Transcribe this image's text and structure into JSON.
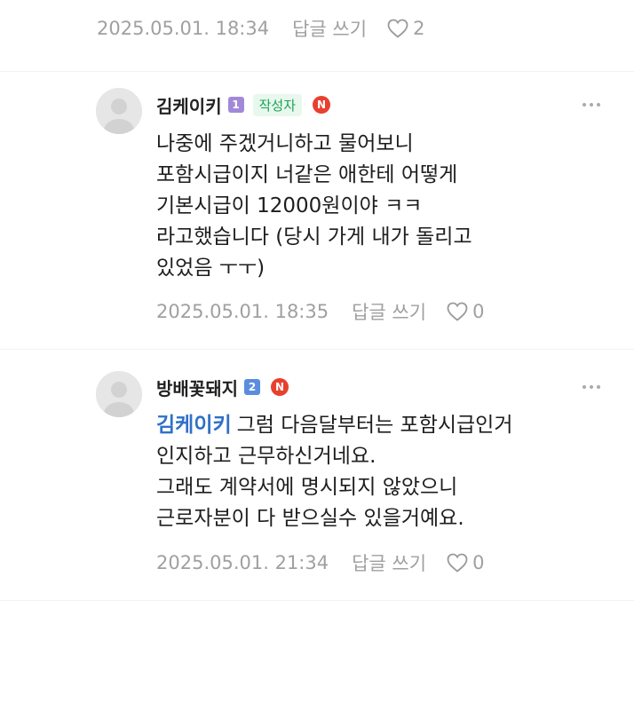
{
  "top_meta": {
    "date": "2025.05.01. 18:34",
    "reply_label": "답글 쓰기",
    "likes": "2"
  },
  "comments": [
    {
      "nickname": "김케이키",
      "level": "1",
      "author_badge": "작성자",
      "new_badge": "N",
      "lines": [
        "나중에 주겠거니하고 물어보니",
        "포함시급이지 너같은 애한테 어떻게",
        "기본시급이 12000원이야 ㅋㅋ",
        "라고했습니다 (당시 가게 내가 돌리고",
        "있었음 ㅜㅜ)"
      ],
      "date": "2025.05.01. 18:35",
      "reply_label": "답글 쓰기",
      "likes": "0"
    },
    {
      "nickname": "방배꽃돼지",
      "level": "2",
      "new_badge": "N",
      "mention": "김케이키",
      "lines": [
        "그럼 다음달부터는 포함시급인거",
        "인지하고 근무하신거네요.",
        "그래도 계약서에 명시되지 않았으니",
        "근로자분이 다 받으실수 있을거예요."
      ],
      "date": "2025.05.01. 21:34",
      "reply_label": "답글 쓰기",
      "likes": "0"
    }
  ]
}
